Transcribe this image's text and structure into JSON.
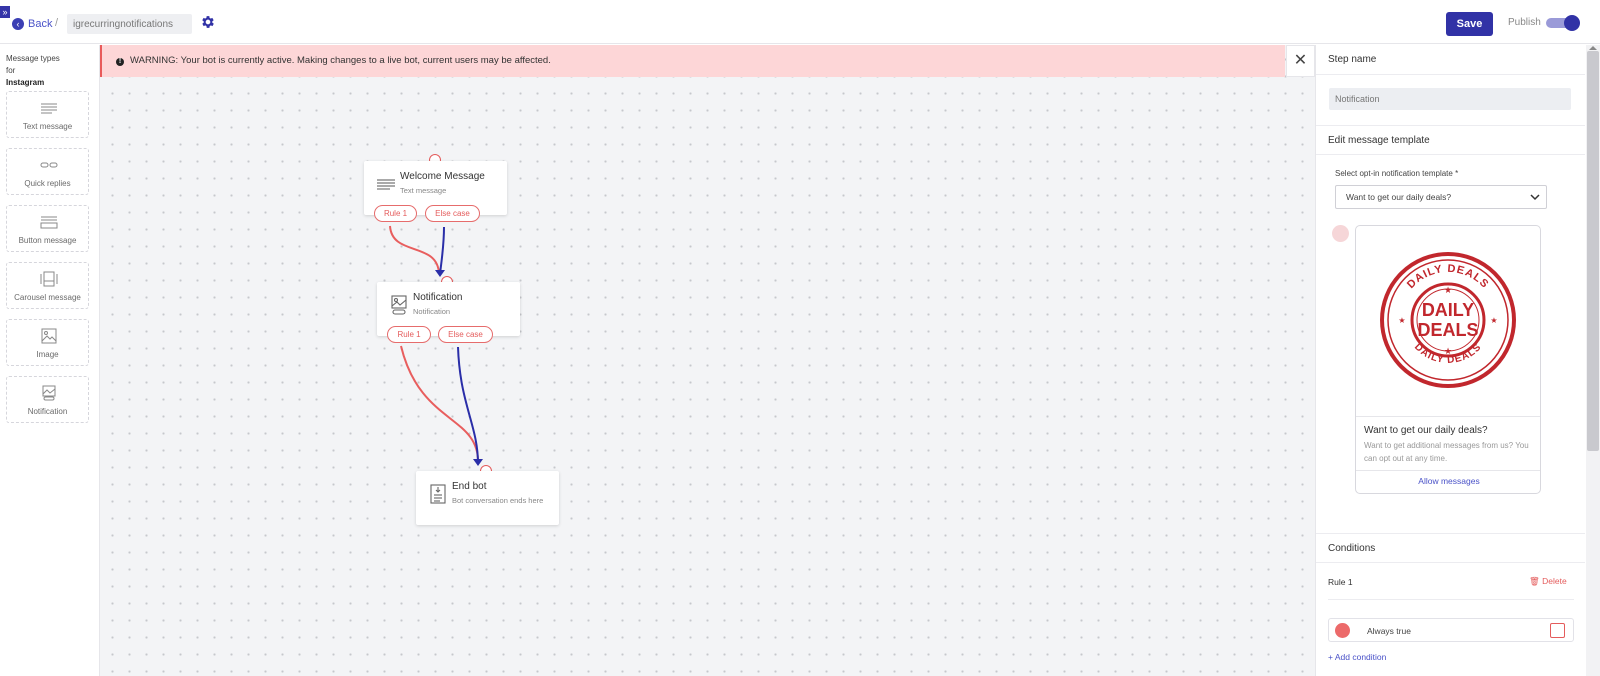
{
  "header": {
    "back_label": "Back",
    "separator": "/",
    "bot_name": "igrecurringnotifications",
    "save_label": "Save",
    "publish_label": "Publish",
    "publish_on": true,
    "accent_color": "#3132a6"
  },
  "palette": {
    "title_line1": "Message types",
    "title_line2": "for",
    "title_platform": "Instagram",
    "items": [
      {
        "label": "Text message",
        "icon": "text-lines-icon"
      },
      {
        "label": "Quick replies",
        "icon": "quick-replies-icon"
      },
      {
        "label": "Button message",
        "icon": "button-message-icon"
      },
      {
        "label": "Carousel message",
        "icon": "carousel-icon"
      },
      {
        "label": "Image",
        "icon": "image-icon"
      },
      {
        "label": "Notification",
        "icon": "notification-icon"
      }
    ]
  },
  "canvas": {
    "warning": "WARNING: Your bot is currently active. Making changes to a live bot, current users may be affected.",
    "close_symbol": "✕",
    "nodes": [
      {
        "title": "Welcome Message",
        "subtitle": "Text message",
        "rules": [
          "Rule 1",
          "Else case"
        ]
      },
      {
        "title": "Notification",
        "subtitle": "Notification",
        "rules": [
          "Rule 1",
          "Else case"
        ]
      },
      {
        "title": "End bot",
        "subtitle": "Bot conversation ends here"
      }
    ],
    "rule_color": "#e45c5c",
    "else_color": "#2a2ea8"
  },
  "panel": {
    "step_name_heading": "Step name",
    "step_name_value": "Notification",
    "edit_template_heading": "Edit message template",
    "template_label": "Select opt-in notification template *",
    "template_selected": "Want to get our daily deals?",
    "preview": {
      "title": "Want to get our daily deals?",
      "body": "Want to get additional messages from us? You can opt out at any time.",
      "button": "Allow messages",
      "stamp_top": "DAILY DEALS",
      "stamp_bottom": "DAILY DEALS",
      "stamp_left": "DAILY",
      "stamp_right": "DEALS",
      "stamp_center_1": "DAILY",
      "stamp_center_2": "DEALS"
    },
    "conditions_heading": "Conditions",
    "rule_label": "Rule 1",
    "delete_label": "Delete",
    "condition_text": "Always true",
    "add_condition": "+ Add condition"
  }
}
